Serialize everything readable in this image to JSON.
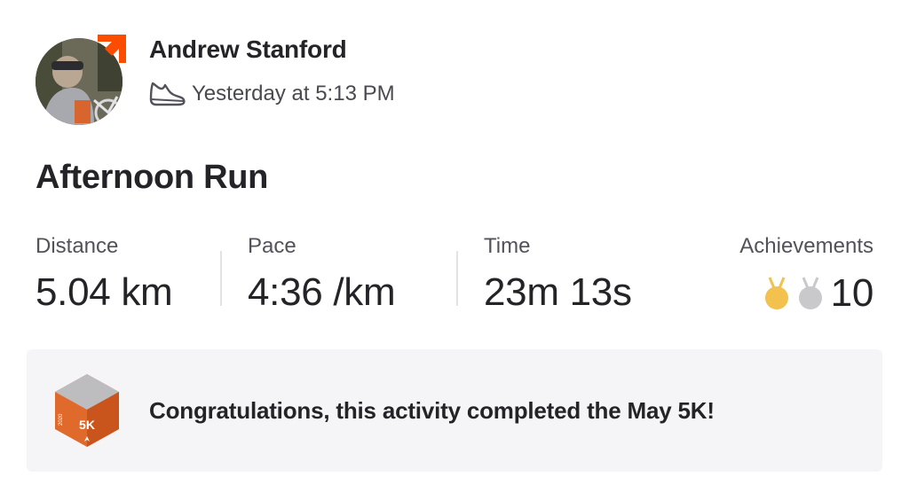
{
  "athlete": {
    "name": "Andrew Stanford",
    "timestamp": "Yesterday at 5:13 PM",
    "activity_icon": "shoe-icon"
  },
  "activity": {
    "title": "Afternoon Run"
  },
  "stats": {
    "distance": {
      "label": "Distance",
      "value": "5.04 km"
    },
    "pace": {
      "label": "Pace",
      "value": "4:36 /km"
    },
    "time": {
      "label": "Time",
      "value": "23m 13s"
    },
    "achievements": {
      "label": "Achievements",
      "count": "10",
      "icons": [
        "gold-medal-icon",
        "silver-medal-icon"
      ]
    }
  },
  "challenge": {
    "message": "Congratulations, this activity completed the May 5K!",
    "badge_text": "5K",
    "badge_year": "2020"
  },
  "colors": {
    "brand_orange": "#fc4c02",
    "badge_orange": "#e06a2b",
    "gold": "#f2c14e",
    "silver": "#c9c9cc",
    "banner_bg": "#f5f5f7"
  }
}
